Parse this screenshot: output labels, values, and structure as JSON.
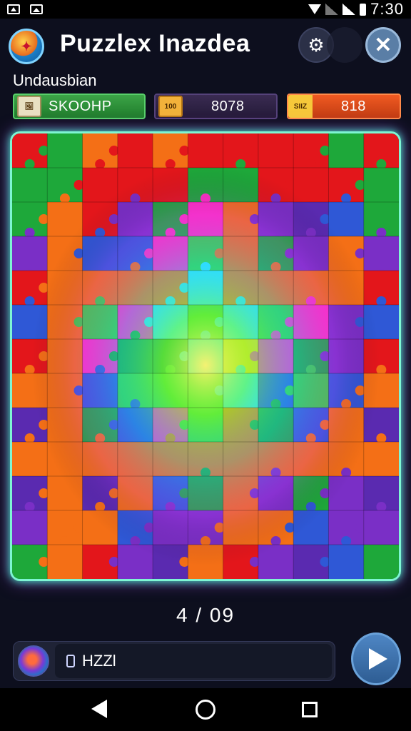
{
  "status_bar": {
    "time": "7:30"
  },
  "header": {
    "title": "Puzzlex Inazdea",
    "settings_icon": "gear-icon",
    "close_icon": "close-icon"
  },
  "subtitle": "Undausbian",
  "stats": [
    {
      "label": "SKOOHP",
      "icon_text": "",
      "color": "#2f9a3d"
    },
    {
      "label": "8078",
      "icon_text": "100",
      "color": "#3a2b52"
    },
    {
      "label": "818",
      "icon_text": "SIIZ",
      "color": "#e84c1c"
    }
  ],
  "board": {
    "grid_cols": 11,
    "grid_rows": 13,
    "palette": [
      "#e3161b",
      "#f46f16",
      "#1ea83a",
      "#39d23a",
      "#5a2ab0",
      "#7a2fc6",
      "#2f58d6",
      "#ffd21a",
      "#33e0ff",
      "#ff2fc0"
    ]
  },
  "progress": {
    "text": "4 / 09"
  },
  "bottom": {
    "input_value": "HZZl",
    "play_icon": "play-icon"
  },
  "nav": {
    "back_icon": "back-icon",
    "home_icon": "home-icon",
    "recent_icon": "recent-apps-icon"
  }
}
